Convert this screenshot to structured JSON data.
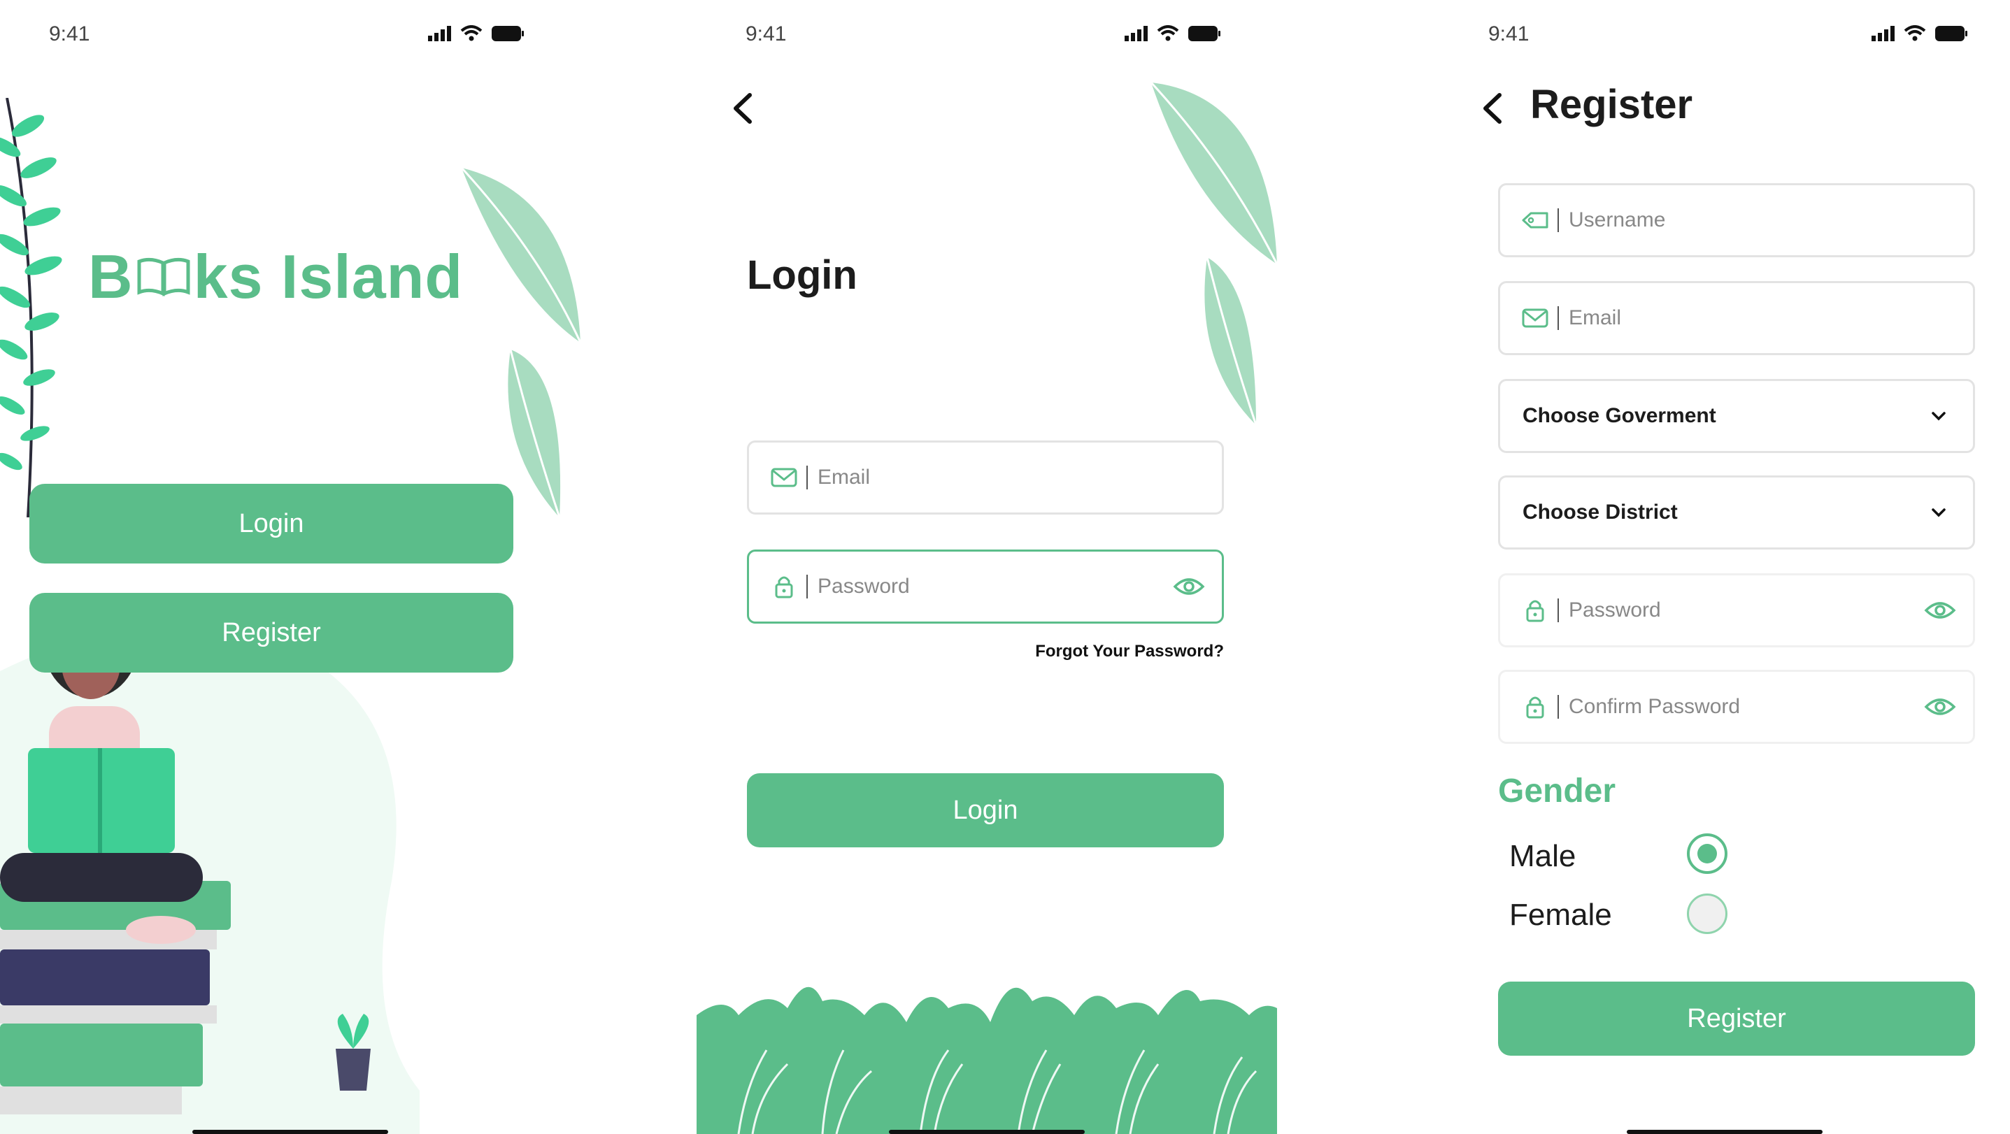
{
  "status": {
    "time": "9:41"
  },
  "screen1": {
    "brand_prefix": "B",
    "brand_suffix": "ks Island",
    "login_label": "Login",
    "register_label": "Register"
  },
  "screen2": {
    "title": "Login",
    "email_placeholder": "Email",
    "password_placeholder": "Password",
    "forgot_label": "Forgot Your Password?",
    "login_label": "Login"
  },
  "screen3": {
    "title": "Register",
    "username_placeholder": "Username",
    "email_placeholder": "Email",
    "government_select": "Choose Goverment",
    "district_select": "Choose District",
    "password_placeholder": "Password",
    "confirm_password_placeholder": "Confirm Password",
    "gender_title": "Gender",
    "gender_options": [
      "Male",
      "Female"
    ],
    "gender_selected": "Male",
    "register_label": "Register"
  },
  "colors": {
    "accent": "#5bbd8a",
    "leaf_light": "#a8dcc0",
    "border": "#e3e3e3"
  },
  "icons": [
    "signal-icon",
    "wifi-icon",
    "battery-icon",
    "back-arrow-icon",
    "mail-icon",
    "lock-icon",
    "eye-icon",
    "user-tag-icon",
    "chevron-down-icon",
    "book-icon",
    "leaf-icon",
    "fern-icon",
    "grass-icon",
    "reader-illustration",
    "plant-pot-icon"
  ]
}
